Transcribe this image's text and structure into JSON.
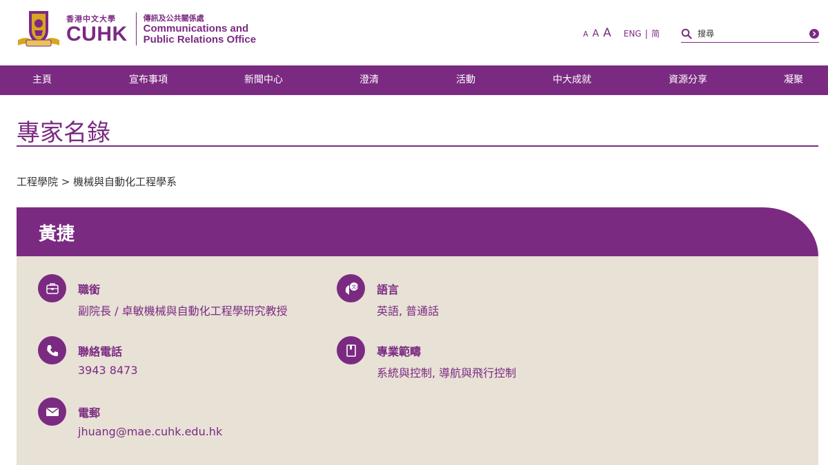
{
  "brand": {
    "zh_name": "香港中文大學",
    "en_abbr": "CUHK",
    "office_zh": "傳訊及公共關係處",
    "office_en_line1": "Communications and",
    "office_en_line2": "Public Relations Office",
    "logo_icon": "cuhk-crest-icon",
    "accent_color": "#7b2a82",
    "panel_color": "#e8e1d6"
  },
  "tools": {
    "font_small": "A",
    "font_medium": "A",
    "font_large": "A",
    "lang_en": "ENG",
    "lang_separator": "|",
    "lang_simplified": "简",
    "search_placeholder": "搜尋"
  },
  "nav": {
    "items": [
      "主頁",
      "宣布事項",
      "新聞中心",
      "澄清",
      "活動",
      "中大成就",
      "資源分享",
      "凝聚"
    ]
  },
  "page": {
    "title": "專家名錄"
  },
  "breadcrumb": {
    "faculty": "工程學院",
    "separator": ">",
    "department": "機械與自動化工程學系"
  },
  "expert": {
    "name": "黃捷",
    "fields": {
      "position": {
        "label": "職銜",
        "value": "副院長 / 卓敏機械與自動化工程學研究教授",
        "icon": "briefcase-icon"
      },
      "phone": {
        "label": "聯絡電話",
        "value": "3943 8473",
        "icon": "phone-icon"
      },
      "email": {
        "label": "電郵",
        "value": "jhuang@mae.cuhk.edu.hk",
        "icon": "envelope-icon"
      },
      "language": {
        "label": "語言",
        "value": "英語, 普通話",
        "icon": "speech-translate-icon"
      },
      "expertise": {
        "label": "專業範疇",
        "value": "系統與控制, 導航與飛行控制",
        "icon": "book-icon"
      }
    }
  }
}
